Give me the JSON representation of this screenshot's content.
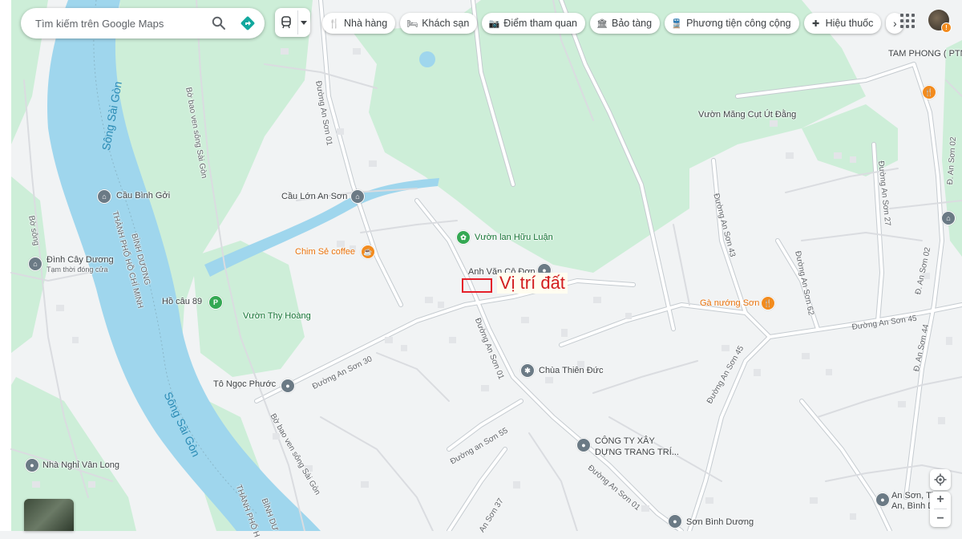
{
  "search": {
    "placeholder": "Tìm kiếm trên Google Maps",
    "search_icon": "search-icon",
    "directions_icon": "directions-icon"
  },
  "layers": {
    "icon": "transit-layer-icon",
    "dropdown_icon": "chevron-down-icon"
  },
  "categories": [
    {
      "label": "Nhà hàng",
      "icon": "restaurant-icon"
    },
    {
      "label": "Khách sạn",
      "icon": "hotel-icon"
    },
    {
      "label": "Điểm tham quan",
      "icon": "camera-icon"
    },
    {
      "label": "Bảo tàng",
      "icon": "museum-icon"
    },
    {
      "label": "Phương tiện công cộng",
      "icon": "transit-icon"
    },
    {
      "label": "Hiệu thuốc",
      "icon": "pharmacy-icon"
    }
  ],
  "account": {
    "notification_badge": "!"
  },
  "annotation": {
    "label": "Vị trí đất",
    "color": "#e5202a"
  },
  "places": {
    "cau_binh_goi": "Cầu Bình Gởi",
    "dinh_cay_duong": "Đình Cây Dương",
    "dinh_cay_duong_status": "Tạm thời đóng cửa",
    "ho_cau_89": "Hồ câu 89",
    "vuon_thy_hoang": "Vườn Thy Hoàng",
    "to_ngoc_phuoc": "Tô Ngọc Phước",
    "nha_nghi_van_long": "Nhà Nghỉ Vân Long",
    "cau_lon_an_son": "Cầu Lớn An Sơn",
    "chim_se_coffee": "Chim Sẻ coffee",
    "vuon_lan_huu_luan": "Vườn lan Hữu Luận",
    "anh_van_co_don": "Anh Văn Cô Đơn",
    "chua_thien_duc": "Chùa Thiên Đức",
    "cong_ty_line1": "CÔNG TY XÂY",
    "cong_ty_line2": "DỰNG TRANG TRÍ...",
    "son_binh_duong": "Sơn Bình Dương",
    "vuon_mang_cut": "Vườn Măng Cụt Út Đằng",
    "ga_nuong_son": "Gà nướng Sơn",
    "tam_phong": "TAM PHONG ( PTN",
    "an_son_1": "An Sơn, Th",
    "an_son_2": "An, Bình D"
  },
  "roads": {
    "an_son_01": "Đường An Sơn 01",
    "an_son_30": "Đường An Sơn 30",
    "an_son_55": "Đường an Sơn 55",
    "an_son_37": "An Sơn 37",
    "an_son_43": "Đường An Sơn 43",
    "an_son_45": "Đường An Sơn 45",
    "an_son_62": "Đường An Sơn 62",
    "an_son_27": "Đường An Sơn 27",
    "an_son_02": "Đ. An Sơn 02",
    "an_son_44": "Đ. An Sơn 44",
    "an_son_02b": "Đ. An Sơn 02",
    "bo_bao_ven_1": "Bờ bao ven sông Sài Gòn",
    "bo_bao_ven_2": "Bờ bao ven sông Sài Gòn",
    "bo_song": "Bờ sông",
    "song_sai_gon_1": "Sông Sài Gòn",
    "song_sai_gon_2": "Sông Sài Gòn",
    "tp_hcm_1": "THÀNH PHỐ HỒ CHÍ MINH",
    "binh_duong_1": "BÌNH DƯƠNG",
    "tp_hcm_2": "THÀNH PHỐ H",
    "binh_duong_2": "BÌNH DƯ"
  },
  "map_controls": {
    "locate_icon": "my-location-icon",
    "zoom_in": "+",
    "zoom_out": "−"
  }
}
